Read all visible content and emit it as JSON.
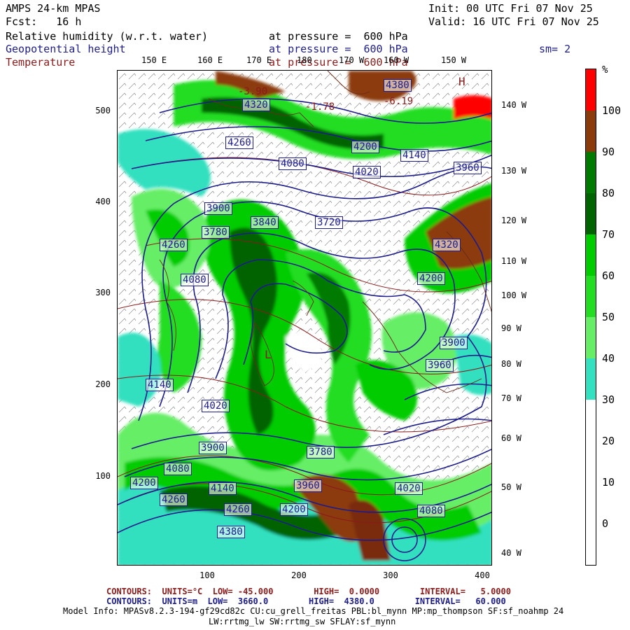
{
  "header": {
    "model": "AMPS 24-km MPAS",
    "fcst": "Fcst:   16 h",
    "init": "Init: 00 UTC Fri 07 Nov 25",
    "valid": "Valid: 16 UTC Fri 07 Nov 25",
    "field1": "Relative humidity (w.r.t. water)",
    "field1_level": "at pressure =  600 hPa",
    "field2": "Geopotential height",
    "field2_level": "at pressure =  600 hPa",
    "field3": "Temperature",
    "field3_level": "at pressure =  600 hPa",
    "smooth": "sm= 2"
  },
  "map": {
    "y_ticks": [
      "500",
      "400",
      "300",
      "200",
      "100"
    ],
    "x_ticks": [
      "100",
      "200",
      "300",
      "400"
    ],
    "lon_top": [
      "150 E",
      "160 E",
      "170 E",
      "180",
      "170 W",
      "160 W",
      "150 W"
    ],
    "lon_right": [
      "140 W",
      "130 W",
      "120 W",
      "110 W",
      "100 W",
      "90 W",
      "80 W",
      "70 W",
      "60 W",
      "50 W",
      "40 W"
    ],
    "height_labels": [
      "4380",
      "4320",
      "4260",
      "4200",
      "4140",
      "4080",
      "4020",
      "3960",
      "3900",
      "3840",
      "3780",
      "3720",
      "4320",
      "4260",
      "4200",
      "4080",
      "3900",
      "3960",
      "4140",
      "4020",
      "3780",
      "4200",
      "4080",
      "4260",
      "4380",
      "4140",
      "3960",
      "4020",
      "3900",
      "4080",
      "4200",
      "4260"
    ],
    "temp_labels": [
      "-3.90",
      "-6.19",
      "-1.78"
    ],
    "high_label": "H",
    "low_label": "L",
    "colors": {
      "contour_height": "#1c1c8c",
      "contour_temp": "#8b1a1a"
    }
  },
  "colorbar": {
    "unit": "%",
    "labels": [
      "100",
      "90",
      "80",
      "70",
      "60",
      "50",
      "40",
      "30",
      "20",
      "10",
      "0"
    ],
    "segments": [
      {
        "value": "100+",
        "color": "#ff0000"
      },
      {
        "value": "90-100",
        "color": "#8b3a0a"
      },
      {
        "value": "80-90",
        "color": "#007a00"
      },
      {
        "value": "70-80",
        "color": "#006400"
      },
      {
        "value": "60-70",
        "color": "#00cc00"
      },
      {
        "value": "50-60",
        "color": "#22dd22"
      },
      {
        "value": "40-50",
        "color": "#66ee66"
      },
      {
        "value": "30-40",
        "color": "#33e0c0"
      },
      {
        "value": "20-30",
        "color": "#ffffff"
      },
      {
        "value": "10-20",
        "color": "#ffffff"
      },
      {
        "value": "0-10",
        "color": "#ffffff"
      },
      {
        "value": "<0",
        "color": "#ffffff"
      }
    ]
  },
  "footer": {
    "contours_temp": "CONTOURS:  UNITS=°C  LOW= -45.000        HIGH=  0.0000        INTERVAL=   5.0000",
    "contours_hgt": "CONTOURS:  UNITS=m  LOW=  3660.0        HIGH=  4380.0        INTERVAL=   60.000",
    "model_info": "Model Info: MPASv8.2.3-194-gf29cd82c CU:cu_grell_freitas PBL:bl_mynn MP:mp_thompson SF:sf_noahmp 24",
    "model_info2": "LW:rrtmg_lw SW:rrtmg_sw SFLAY:sf_mynn"
  }
}
